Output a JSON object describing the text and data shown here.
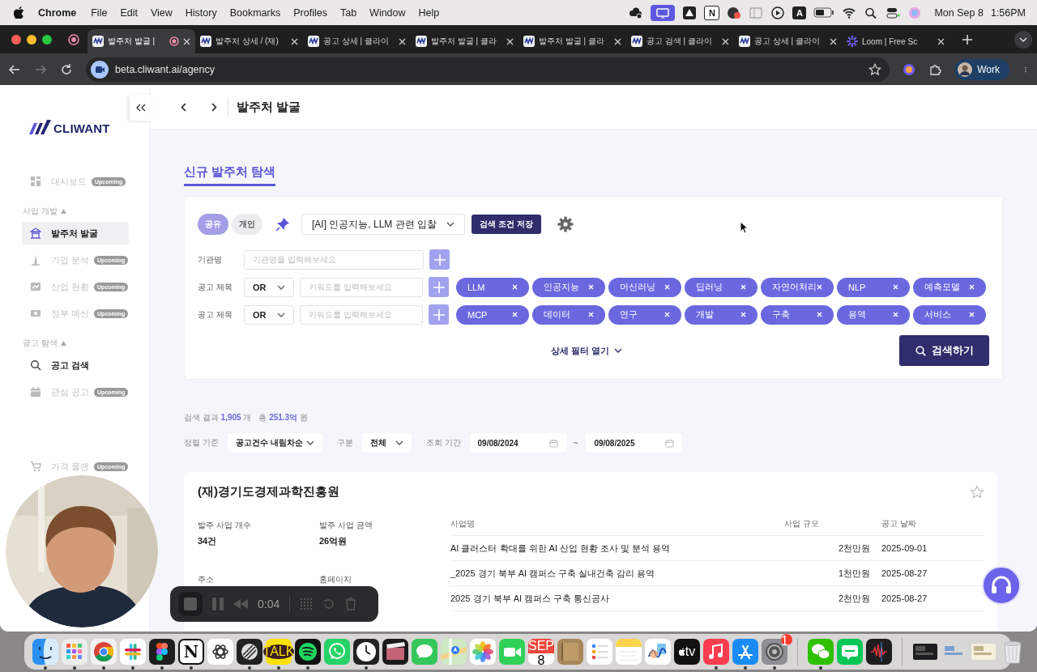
{
  "menu_bar": {
    "app": "Chrome",
    "menus": [
      "File",
      "Edit",
      "View",
      "History",
      "Bookmarks",
      "Profiles",
      "Tab",
      "Window",
      "Help"
    ],
    "status_glyphs": [
      "N",
      "A"
    ],
    "date": "Mon Sep 8",
    "time": "1:56PM"
  },
  "browser": {
    "tabs": [
      {
        "title": "발주처 발굴 |",
        "selected": true
      },
      {
        "title": "발주처 상세 / (재)",
        "selected": false
      },
      {
        "title": "공고 상세 | 클라이",
        "selected": false
      },
      {
        "title": "발주처 발굴 | 클라",
        "selected": false
      },
      {
        "title": "발주처 발굴 | 클라",
        "selected": false
      },
      {
        "title": "공고 검색 | 클라이",
        "selected": false
      },
      {
        "title": "공고 상세 | 클라이",
        "selected": false
      },
      {
        "title": "Loom | Free Sc",
        "selected": false,
        "kind": "loom"
      }
    ],
    "url": "beta.cliwant.ai/agency",
    "profile": "Work"
  },
  "app": {
    "logo": "CLIWANT",
    "sidebar": {
      "items": [
        {
          "kind": "item",
          "label": "대시보드",
          "badge": "Upcoming",
          "disabled": true,
          "selected": false
        },
        {
          "kind": "section",
          "label": "사업 개발",
          "expanded": true
        },
        {
          "kind": "item",
          "label": "발주처 발굴",
          "disabled": false,
          "selected": true
        },
        {
          "kind": "item",
          "label": "기업 분석",
          "badge": "Upcoming",
          "disabled": true,
          "selected": false
        },
        {
          "kind": "item",
          "label": "산업 현황",
          "badge": "Upcoming",
          "disabled": true,
          "selected": false
        },
        {
          "kind": "item",
          "label": "정부 예산",
          "badge": "Upcoming",
          "disabled": true,
          "selected": false
        },
        {
          "kind": "section",
          "label": "공고 탐색",
          "expanded": true
        },
        {
          "kind": "item",
          "label": "공고 검색",
          "disabled": false,
          "selected": false
        },
        {
          "kind": "item",
          "label": "관심 공고",
          "badge": "Upcoming",
          "disabled": true,
          "selected": false
        },
        {
          "kind": "item",
          "label": "가격 플랜",
          "badge": "Upcoming",
          "disabled": true,
          "selected": false
        }
      ]
    },
    "page_title": "발주처 발굴",
    "section_tab": "신규 발주처 탐색",
    "filter": {
      "scope_tabs": [
        {
          "label": "공유",
          "selected": true
        },
        {
          "label": "개인",
          "selected": false
        }
      ],
      "preset": "[AI] 인공지능, LLM 관련 입찰",
      "save_button": "검색 조건 저장",
      "org_row": {
        "label": "기관명",
        "placeholder": "기관명을 입력해보세요"
      },
      "keyword_rows": [
        {
          "label": "공고 제목",
          "operator": "OR",
          "placeholder": "키워드를 입력해보세요",
          "chips": [
            "LLM",
            "인공지능",
            "머신러닝",
            "딥러닝",
            "자연어처리",
            "NLP",
            "예측모델"
          ]
        },
        {
          "label": "공고 제목",
          "operator": "OR",
          "placeholder": "키워드를 입력해보세요",
          "chips": [
            "MCP",
            "데이터",
            "연구",
            "개발",
            "구축",
            "용역",
            "서비스"
          ]
        }
      ],
      "more_filters": "상세 필터 열기",
      "search_button": "검색하기"
    },
    "summary": [
      {
        "label": "검색 결과",
        "value": "1,905",
        "unit": "개"
      },
      {
        "label": "총",
        "value": "251.3억",
        "unit": "원"
      }
    ],
    "sort": {
      "label": "정렬 기준",
      "value": "공고건수 내림차순"
    },
    "category": {
      "label": "구분",
      "value": "전체"
    },
    "period": {
      "label": "조회 기간",
      "from": "09/08/2024",
      "separator": "~",
      "to": "09/08/2025"
    },
    "result_card": {
      "name": "(재)경기도경제과학진흥원",
      "starred": false,
      "stats": [
        {
          "label": "발주 사업 개수",
          "value": "34건"
        },
        {
          "label": "발주 사업 금액",
          "value": "26억원"
        },
        {
          "label": "주소"
        },
        {
          "label": "홈페이지"
        }
      ],
      "table": {
        "columns": [
          "사업명",
          "사업 규모",
          "공고 날짜"
        ],
        "rows": [
          [
            "AI 클러스터 확대를 위한 AI 산업 현황 조사 및 분석 용역",
            "2천만원",
            "2025-09-01"
          ],
          [
            "_2025 경기 북부 AI 캠퍼스 구축 실내건축 감리 용역",
            "1천만원",
            "2025-08-27"
          ],
          [
            "2025 경기 북부 AI 캠퍼스 구축 통신공사",
            "2천만원",
            "2025-08-27"
          ]
        ]
      }
    }
  },
  "recorder": {
    "time": "0:04"
  },
  "dock": {
    "apps": [
      {
        "kind": "finder",
        "running": true
      },
      {
        "kind": "launchpad",
        "running": true
      },
      {
        "kind": "chrome",
        "running": true
      },
      {
        "kind": "slack",
        "running": true
      },
      {
        "kind": "figma",
        "running": true
      },
      {
        "kind": "notion",
        "glyph": "N",
        "running": true
      },
      {
        "kind": "chatgpt",
        "running": false
      },
      {
        "kind": "linear",
        "running": true
      },
      {
        "kind": "kakao",
        "glyph": "TALK",
        "running": true
      },
      {
        "kind": "spotify",
        "running": true
      },
      {
        "kind": "whatsapp",
        "running": false
      },
      {
        "kind": "clock",
        "running": true
      },
      {
        "kind": "video",
        "running": false
      },
      {
        "kind": "messages",
        "running": false
      },
      {
        "kind": "maps",
        "running": false
      },
      {
        "kind": "photos",
        "running": false
      },
      {
        "kind": "facetime",
        "running": false
      },
      {
        "kind": "calendar",
        "month": "SEP",
        "day": "8",
        "running": false
      },
      {
        "kind": "notebook",
        "running": false
      },
      {
        "kind": "reminders",
        "running": false
      },
      {
        "kind": "notes",
        "running": false
      },
      {
        "kind": "freeform",
        "running": false
      },
      {
        "kind": "tv",
        "glyph": "tv",
        "running": false
      },
      {
        "kind": "music",
        "running": true
      },
      {
        "kind": "appstore",
        "running": true
      },
      {
        "kind": "settings",
        "badge": "1",
        "running": true
      },
      {
        "kind": "separator"
      },
      {
        "kind": "wechat",
        "running": true
      },
      {
        "kind": "chat",
        "running": false
      },
      {
        "kind": "recorder",
        "running": false
      },
      {
        "kind": "separator"
      },
      {
        "kind": "thumbnail",
        "running": false
      },
      {
        "kind": "thumbnail",
        "running": false
      },
      {
        "kind": "thumbnail",
        "running": false
      },
      {
        "kind": "trash",
        "running": false
      }
    ]
  }
}
